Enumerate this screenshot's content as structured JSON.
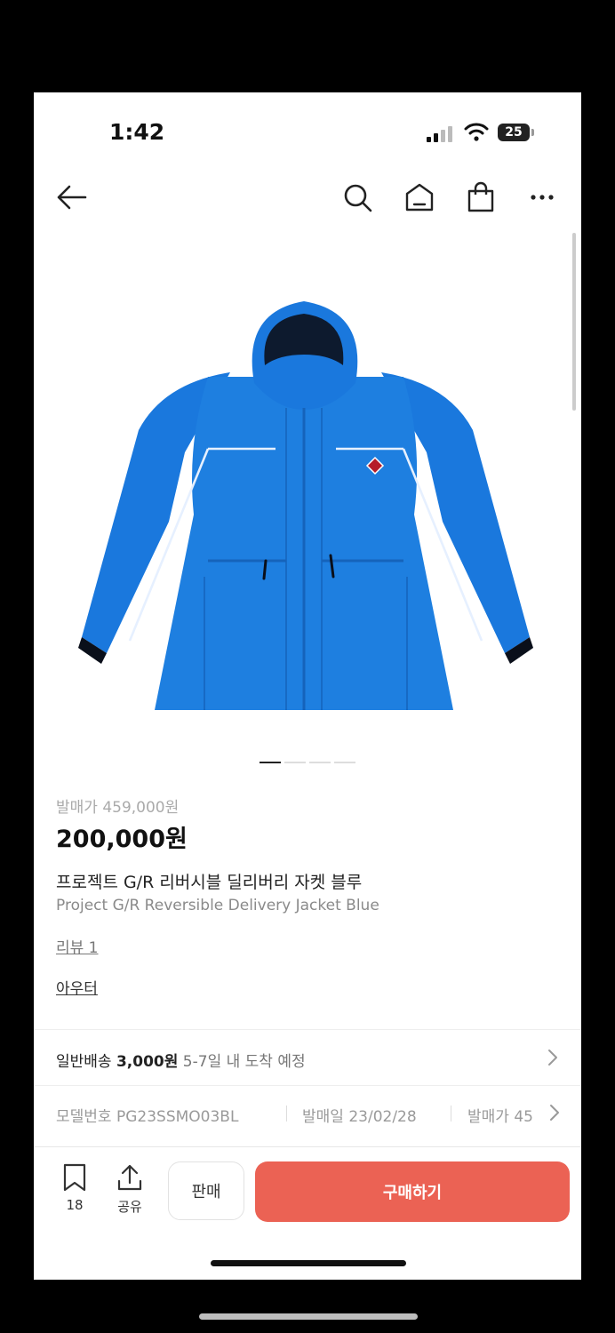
{
  "status_bar": {
    "time": "1:42",
    "battery": "25"
  },
  "product": {
    "release_price_label": "발매가 459,000원",
    "price": "200,000원",
    "title_ko": "프로젝트 G/R 리버시블 딜리버리 자켓 블루",
    "title_en": "Project G/R Reversible Delivery Jacket Blue",
    "review_link": "리뷰 1",
    "category_link": "아우터"
  },
  "carousel": {
    "count": 4,
    "active_index": 0
  },
  "shipping": {
    "label": "일반배송",
    "fee": "3,000원",
    "eta": "5-7일 내 도착 예정"
  },
  "info": {
    "model_label": "모델번호",
    "model_value": "PG23SSMO03BL",
    "release_date_label": "발매일",
    "release_date_value": "23/02/28",
    "release_price_label": "발매가",
    "release_price_value": "45"
  },
  "bottom_bar": {
    "bookmark_count": "18",
    "share_label": "공유",
    "sell_label": "판매",
    "buy_label": "구매하기"
  },
  "colors": {
    "accent": "#eb6254",
    "jacket": "#1e7fe0"
  },
  "icons": [
    "back-arrow-icon",
    "search-icon",
    "home-icon",
    "shopping-bag-icon",
    "more-icon",
    "bookmark-icon",
    "share-icon",
    "chevron-right-icon"
  ]
}
